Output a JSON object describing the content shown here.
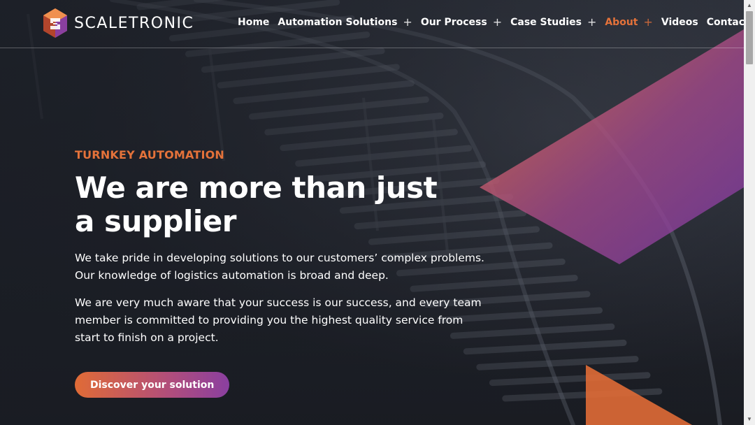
{
  "brand": {
    "name": "SCALETRONIC",
    "logo_icon": "hexagon-s-logo-icon"
  },
  "nav": {
    "items": [
      {
        "label": "Home",
        "has_submenu": false,
        "active": false
      },
      {
        "label": "Automation Solutions",
        "has_submenu": true,
        "active": false
      },
      {
        "label": "Our Process",
        "has_submenu": true,
        "active": false
      },
      {
        "label": "Case Studies",
        "has_submenu": true,
        "active": false
      },
      {
        "label": "About",
        "has_submenu": true,
        "active": true
      },
      {
        "label": "Videos",
        "has_submenu": false,
        "active": false
      },
      {
        "label": "Contact",
        "has_submenu": false,
        "active": false
      }
    ],
    "submenu_glyph": "+"
  },
  "hero": {
    "eyebrow": "TURNKEY AUTOMATION",
    "headline_line1": "We are more than just",
    "headline_line2": "a supplier",
    "paragraph1_line1": "We take pride in developing solutions to our customers’ complex problems.",
    "paragraph1_line2": "Our knowledge of logistics automation is broad and deep.",
    "paragraph2_line1": "We are very much aware that your success is our success, and every team",
    "paragraph2_line2": "member is committed to providing you the highest quality service from",
    "paragraph2_line3": "start to finish on a project.",
    "cta_label": "Discover your solution"
  },
  "colors": {
    "accent_orange": "#e4723a",
    "accent_purple": "#8a3fa0",
    "background": "#1e2129"
  },
  "scrollbar": {
    "up_glyph": "▲",
    "down_glyph": "▼"
  }
}
